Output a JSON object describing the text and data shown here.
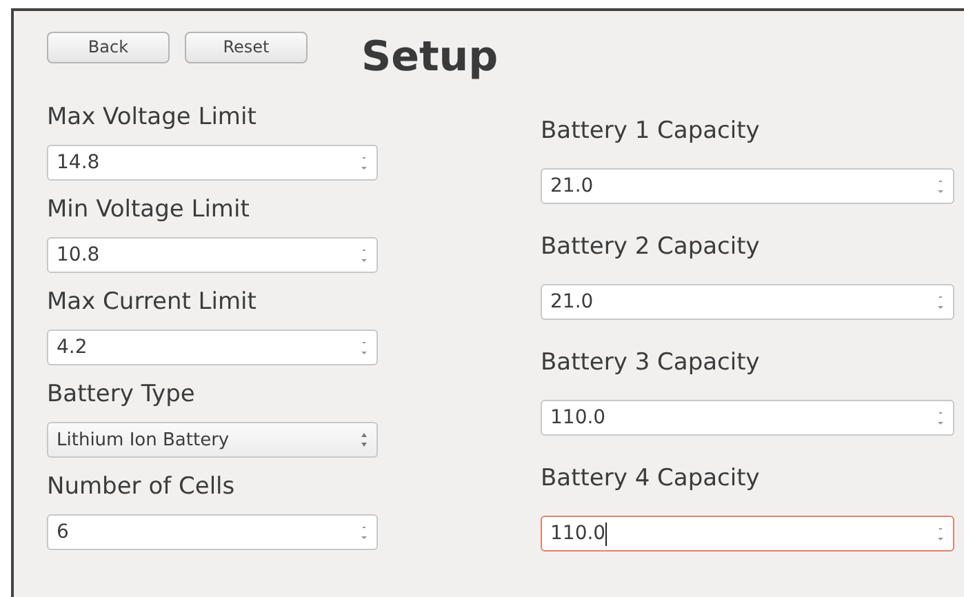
{
  "buttons": [
    {
      "label": "Back"
    },
    {
      "label": "Reset"
    }
  ],
  "title": "Setup",
  "left_fields": [
    {
      "label": "Max Voltage Limit",
      "kind": "spin",
      "value": "14.8",
      "focused": false
    },
    {
      "label": "Min Voltage Limit",
      "kind": "spin",
      "value": "10.8",
      "focused": false
    },
    {
      "label": "Max Current Limit",
      "kind": "spin",
      "value": "4.2",
      "focused": false
    },
    {
      "label": "Battery Type",
      "kind": "combo",
      "value": "Lithium Ion Battery",
      "focused": false
    },
    {
      "label": "Number of Cells",
      "kind": "spin",
      "value": "6",
      "focused": false
    }
  ],
  "right_fields": [
    {
      "label": "Battery 1 Capacity",
      "kind": "spin",
      "value": "21.0",
      "focused": false
    },
    {
      "label": "Battery 2 Capacity",
      "kind": "spin",
      "value": "21.0",
      "focused": false
    },
    {
      "label": "Battery 3 Capacity",
      "kind": "spin",
      "value": "110.0",
      "focused": false
    },
    {
      "label": "Battery 4 Capacity",
      "kind": "spin",
      "value": "110.0",
      "focused": true
    }
  ]
}
